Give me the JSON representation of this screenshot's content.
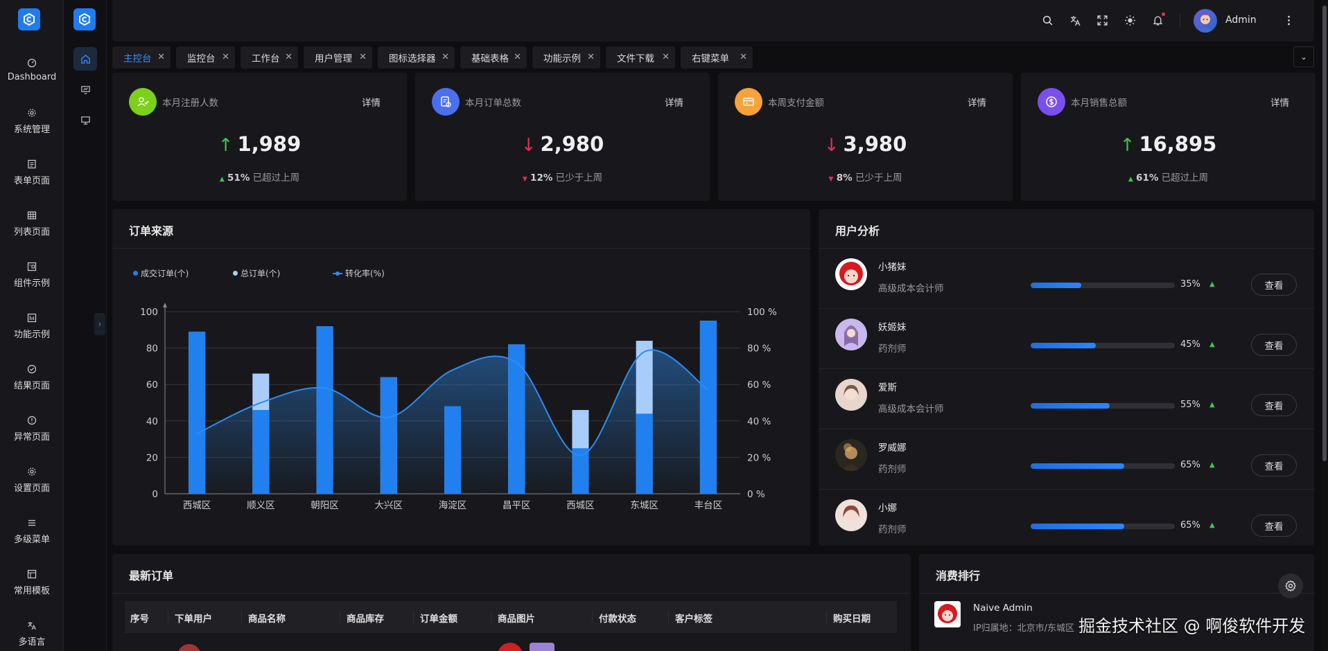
{
  "rail": {
    "items": [
      {
        "label": "Dashboard",
        "icon": "dashboard-icon"
      },
      {
        "label": "系统管理",
        "icon": "gear-icon"
      },
      {
        "label": "表单页面",
        "icon": "form-icon"
      },
      {
        "label": "列表页面",
        "icon": "table-icon"
      },
      {
        "label": "组件示例",
        "icon": "component-icon"
      },
      {
        "label": "功能示例",
        "icon": "function-icon"
      },
      {
        "label": "结果页面",
        "icon": "check-circle-icon"
      },
      {
        "label": "异常页面",
        "icon": "alert-circle-icon"
      },
      {
        "label": "设置页面",
        "icon": "gear-icon"
      },
      {
        "label": "多级菜单",
        "icon": "menu-icon"
      },
      {
        "label": "常用模板",
        "icon": "template-icon"
      },
      {
        "label": "多语言",
        "icon": "translate-icon"
      }
    ]
  },
  "header": {
    "username": "Admin",
    "accent": "#1f7cf0"
  },
  "tabs": [
    {
      "label": "主控台",
      "active": true
    },
    {
      "label": "监控台",
      "active": false
    },
    {
      "label": "工作台",
      "active": false
    },
    {
      "label": "用户管理",
      "active": false
    },
    {
      "label": "图标选择器",
      "active": false
    },
    {
      "label": "基础表格",
      "active": false
    },
    {
      "label": "功能示例",
      "active": false
    },
    {
      "label": "文件下载",
      "active": false
    },
    {
      "label": "右键菜单",
      "active": false
    }
  ],
  "stats": [
    {
      "title": "本月注册人数",
      "detail": "详情",
      "value": "1,989",
      "direction": "up",
      "percent": "51%",
      "trend": "已超过上周",
      "color": "#7ccf1a"
    },
    {
      "title": "本月订单总数",
      "detail": "详情",
      "value": "2,980",
      "direction": "down",
      "percent": "12%",
      "trend": "已少于上周",
      "color": "#4b6ff0"
    },
    {
      "title": "本周支付金额",
      "detail": "详情",
      "value": "3,980",
      "direction": "down",
      "percent": "8%",
      "trend": "已少于上周",
      "color": "#f5a33a"
    },
    {
      "title": "本月销售总额",
      "detail": "详情",
      "value": "16,895",
      "direction": "up",
      "percent": "61%",
      "trend": "已超过上周",
      "color": "#7a4ff0"
    }
  ],
  "orders_source": {
    "title": "订单来源"
  },
  "chart_data": {
    "type": "bar",
    "categories": [
      "西城区",
      "顺义区",
      "朝阳区",
      "大兴区",
      "海淀区",
      "昌平区",
      "西城区",
      "东城区",
      "丰台区"
    ],
    "series": [
      {
        "name": "成交订单(个)",
        "type": "bar",
        "values": [
          89,
          46,
          92,
          64,
          48,
          82,
          25,
          44,
          95
        ],
        "color": "#2080f0"
      },
      {
        "name": "总订单(个)",
        "type": "bar",
        "values": [
          89,
          66,
          92,
          64,
          48,
          82,
          46,
          84,
          95
        ],
        "color": "#a9cdfa"
      },
      {
        "name": "转化率(%)",
        "type": "line",
        "values": [
          33,
          50,
          58,
          42,
          68,
          72,
          21,
          78,
          57
        ],
        "color": "#2e8cf0"
      }
    ],
    "ylim": [
      0,
      100
    ],
    "y_ticks": [
      0,
      20,
      40,
      60,
      80,
      100
    ],
    "y2lim": [
      0,
      100
    ],
    "y2_ticks": [
      "0 %",
      "20 %",
      "40 %",
      "60 %",
      "80 %",
      "100 %"
    ],
    "legend_position": "top-left",
    "grid": true
  },
  "user_analysis": {
    "title": "用户分析",
    "view_label": "查看",
    "users": [
      {
        "name": "小猪妹",
        "role": "高级成本会计师",
        "progress": 35,
        "percent_label": "35%"
      },
      {
        "name": "妖姬妹",
        "role": "药剂师",
        "progress": 45,
        "percent_label": "45%"
      },
      {
        "name": "爱斯",
        "role": "高级成本会计师",
        "progress": 55,
        "percent_label": "55%"
      },
      {
        "name": "罗威娜",
        "role": "药剂师",
        "progress": 65,
        "percent_label": "65%"
      },
      {
        "name": "小娜",
        "role": "药剂师",
        "progress": 65,
        "percent_label": "65%"
      }
    ]
  },
  "latest_orders": {
    "title": "最新订单",
    "columns": [
      "序号",
      "下单用户",
      "商品名称",
      "商品库存",
      "订单金额",
      "商品图片",
      "付款状态",
      "客户标签",
      "购买日期"
    ]
  },
  "ranking": {
    "title": "消费排行",
    "top": {
      "name": "Naive Admin",
      "ip": "IP归属地：北京市/东城区"
    }
  },
  "watermark": "掘金技术社区 @ 啊俊软件开发"
}
